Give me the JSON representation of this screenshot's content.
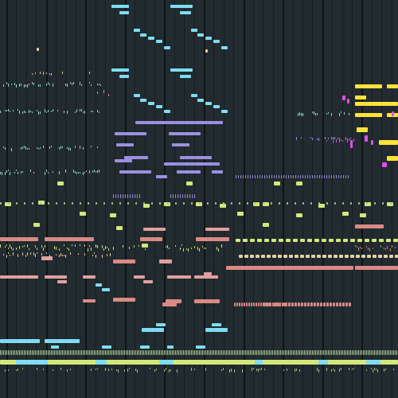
{
  "editor": {
    "view": "piano-roll",
    "grid": true,
    "background": "#222b2f",
    "grid_color": "#161d20"
  },
  "track_colors": {
    "cyan": "#7fdcf2",
    "lavender": "#9b90e0",
    "yellow": "#ffe338",
    "magenta": "#e04fe8",
    "salmon": "#d98a86",
    "pink": "#e0a0a0",
    "lime": "#d2e87a",
    "sage": "#a8c890",
    "cream": "#e6d2a0",
    "mint": "#9ce0c8"
  }
}
